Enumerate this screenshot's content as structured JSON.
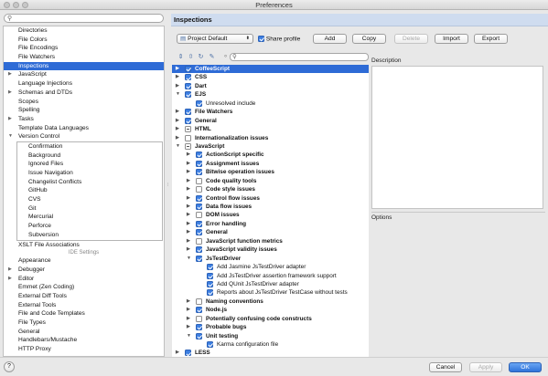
{
  "window": {
    "title": "Preferences"
  },
  "left": {
    "search_placeholder": "",
    "items_top": [
      {
        "label": "Directories",
        "arrow": ""
      },
      {
        "label": "File Colors",
        "arrow": ""
      },
      {
        "label": "File Encodings",
        "arrow": ""
      },
      {
        "label": "File Watchers",
        "arrow": ""
      },
      {
        "label": "Inspections",
        "arrow": "",
        "selected": true
      },
      {
        "label": "JavaScript",
        "arrow": "▶"
      },
      {
        "label": "Language Injections",
        "arrow": ""
      },
      {
        "label": "Schemas and DTDs",
        "arrow": "▶"
      },
      {
        "label": "Scopes",
        "arrow": ""
      },
      {
        "label": "Spelling",
        "arrow": ""
      },
      {
        "label": "Tasks",
        "arrow": "▶"
      },
      {
        "label": "Template Data Languages",
        "arrow": ""
      },
      {
        "label": "Version Control",
        "arrow": "▼"
      }
    ],
    "vc_children": [
      "Confirmation",
      "Background",
      "Ignored Files",
      "Issue Navigation",
      "Changelist Conflicts",
      "GitHub",
      "CVS",
      "Git",
      "Mercurial",
      "Perforce",
      "Subversion"
    ],
    "items_mid": [
      {
        "label": "XSLT File Associations",
        "arrow": ""
      }
    ],
    "ide_header": "IDE Settings",
    "items_ide": [
      {
        "label": "Appearance",
        "arrow": ""
      },
      {
        "label": "Debugger",
        "arrow": "▶"
      },
      {
        "label": "Editor",
        "arrow": "▶"
      },
      {
        "label": "Emmet (Zen Coding)",
        "arrow": ""
      },
      {
        "label": "External Diff Tools",
        "arrow": ""
      },
      {
        "label": "External Tools",
        "arrow": ""
      },
      {
        "label": "File and Code Templates",
        "arrow": ""
      },
      {
        "label": "File Types",
        "arrow": ""
      },
      {
        "label": "General",
        "arrow": ""
      },
      {
        "label": "Handlebars/Mustache",
        "arrow": ""
      },
      {
        "label": "HTTP Proxy",
        "arrow": ""
      }
    ]
  },
  "panel": {
    "title": "Inspections",
    "profile_select": "Project Default",
    "share_profile": "Share profile",
    "buttons": {
      "add": "Add",
      "copy": "Copy",
      "delete": "Delete",
      "import": "Import",
      "export": "Export"
    },
    "filter_placeholder": "",
    "description_label": "Description",
    "options_label": "Options",
    "inspections": [
      {
        "label": "CoffeeScript",
        "level": 1,
        "arrow": "▶",
        "check": "on",
        "selected": true
      },
      {
        "label": "CSS",
        "level": 1,
        "arrow": "▶",
        "check": "on"
      },
      {
        "label": "Dart",
        "level": 1,
        "arrow": "▶",
        "check": "on"
      },
      {
        "label": "EJS",
        "level": 1,
        "arrow": "▼",
        "check": "on"
      },
      {
        "label": "Unresolved include",
        "level": 2,
        "arrow": "",
        "check": "on"
      },
      {
        "label": "File Watchers",
        "level": 1,
        "arrow": "▶",
        "check": "on"
      },
      {
        "label": "General",
        "level": 1,
        "arrow": "▶",
        "check": "on"
      },
      {
        "label": "HTML",
        "level": 1,
        "arrow": "▶",
        "check": "part"
      },
      {
        "label": "Internationalization issues",
        "level": 1,
        "arrow": "▶",
        "check": "off"
      },
      {
        "label": "JavaScript",
        "level": 1,
        "arrow": "▼",
        "check": "part"
      },
      {
        "label": "ActionScript specific",
        "level": 2,
        "arrow": "▶",
        "check": "on",
        "bold": true
      },
      {
        "label": "Assignment issues",
        "level": 2,
        "arrow": "▶",
        "check": "on",
        "bold": true
      },
      {
        "label": "Bitwise operation issues",
        "level": 2,
        "arrow": "▶",
        "check": "on",
        "bold": true
      },
      {
        "label": "Code quality tools",
        "level": 2,
        "arrow": "▶",
        "check": "off",
        "bold": true
      },
      {
        "label": "Code style issues",
        "level": 2,
        "arrow": "▶",
        "check": "off",
        "bold": true
      },
      {
        "label": "Control flow issues",
        "level": 2,
        "arrow": "▶",
        "check": "on",
        "bold": true
      },
      {
        "label": "Data flow issues",
        "level": 2,
        "arrow": "▶",
        "check": "on",
        "bold": true
      },
      {
        "label": "DOM issues",
        "level": 2,
        "arrow": "▶",
        "check": "off",
        "bold": true
      },
      {
        "label": "Error handling",
        "level": 2,
        "arrow": "▶",
        "check": "on",
        "bold": true
      },
      {
        "label": "General",
        "level": 2,
        "arrow": "▶",
        "check": "on",
        "bold": true
      },
      {
        "label": "JavaScript function metrics",
        "level": 2,
        "arrow": "▶",
        "check": "off",
        "bold": true
      },
      {
        "label": "JavaScript validity issues",
        "level": 2,
        "arrow": "▶",
        "check": "on",
        "bold": true
      },
      {
        "label": "JsTestDriver",
        "level": 2,
        "arrow": "▼",
        "check": "on",
        "bold": true
      },
      {
        "label": "Add Jasmine JsTestDriver adapter",
        "level": 3,
        "arrow": "",
        "check": "on"
      },
      {
        "label": "Add JsTestDriver assertion framework support",
        "level": 3,
        "arrow": "",
        "check": "on"
      },
      {
        "label": "Add QUnit JsTestDriver adapter",
        "level": 3,
        "arrow": "",
        "check": "on"
      },
      {
        "label": "Reports about JsTestDriver TestCase without tests",
        "level": 3,
        "arrow": "",
        "check": "on"
      },
      {
        "label": "Naming conventions",
        "level": 2,
        "arrow": "▶",
        "check": "off",
        "bold": true
      },
      {
        "label": "Node.js",
        "level": 2,
        "arrow": "▶",
        "check": "on",
        "bold": true
      },
      {
        "label": "Potentially confusing code constructs",
        "level": 2,
        "arrow": "▶",
        "check": "off",
        "bold": true
      },
      {
        "label": "Probable bugs",
        "level": 2,
        "arrow": "▶",
        "check": "on",
        "bold": true
      },
      {
        "label": "Unit testing",
        "level": 2,
        "arrow": "▼",
        "check": "on",
        "bold": true
      },
      {
        "label": "Karma configuration file",
        "level": 3,
        "arrow": "",
        "check": "on"
      },
      {
        "label": "LESS",
        "level": 1,
        "arrow": "▶",
        "check": "on"
      }
    ]
  },
  "footer": {
    "help": "?",
    "cancel": "Cancel",
    "apply": "Apply",
    "ok": "OK"
  }
}
